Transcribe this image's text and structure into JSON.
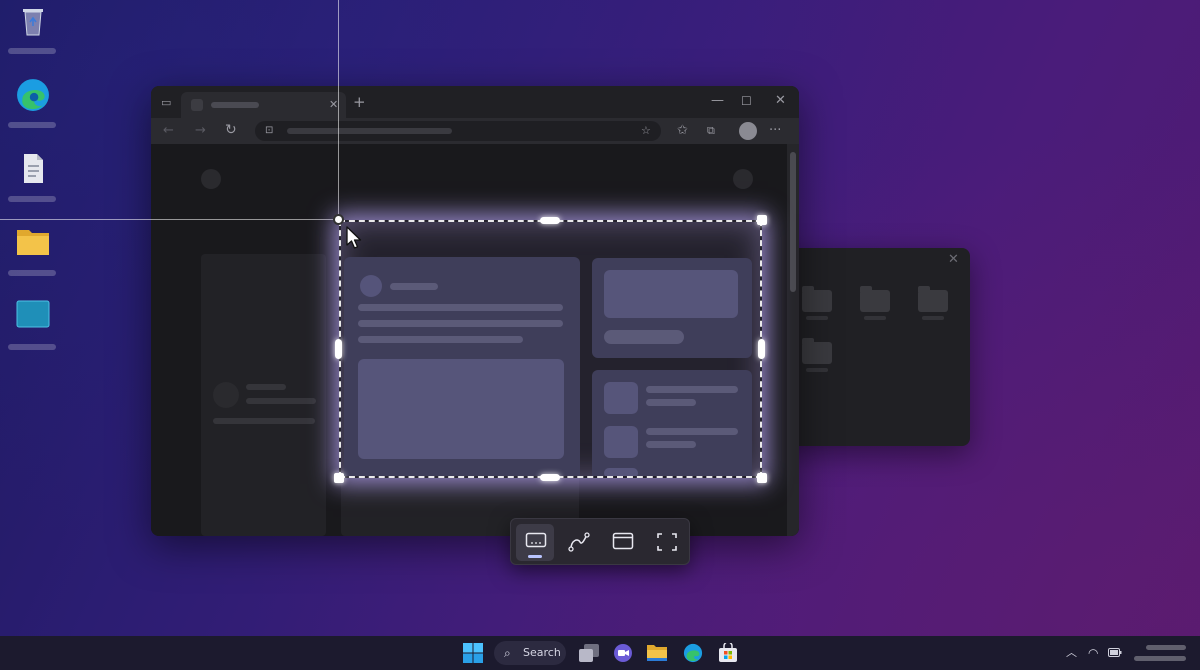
{
  "desktop": {
    "icons": [
      {
        "name": "Recycle Bin",
        "icon": "recycle-bin-icon"
      },
      {
        "name": "Microsoft Edge",
        "icon": "edge-icon"
      },
      {
        "name": "Document",
        "icon": "document-icon"
      },
      {
        "name": "Folder",
        "icon": "folder-icon"
      },
      {
        "name": "Image",
        "icon": "image-icon"
      }
    ]
  },
  "browser": {
    "new_tab_glyph": "+",
    "back_glyph": "←",
    "forward_glyph": "→",
    "refresh_glyph": "↻",
    "more_glyph": "···"
  },
  "snipping_toolbar": {
    "modes": [
      {
        "mode": "rectangle",
        "icon": "rectangle-mode-icon",
        "active": true
      },
      {
        "mode": "freeform",
        "icon": "freeform-mode-icon",
        "active": false
      },
      {
        "mode": "window",
        "icon": "window-mode-icon",
        "active": false
      },
      {
        "mode": "fullscreen",
        "icon": "fullscreen-mode-icon",
        "active": false
      }
    ]
  },
  "taskbar": {
    "search_label": "Search",
    "apps": [
      "start-icon",
      "task-view-icon",
      "chat-icon",
      "file-explorer-icon",
      "edge-icon",
      "store-icon"
    ],
    "tray": [
      "chevron-up-icon",
      "wifi-icon",
      "battery-icon"
    ]
  },
  "colors": {
    "selection_glow": "#beaaff",
    "snip_active_indicator": "#b9c4ff",
    "wallpaper_start": "#1d1a5e",
    "wallpaper_end": "#521a70"
  }
}
